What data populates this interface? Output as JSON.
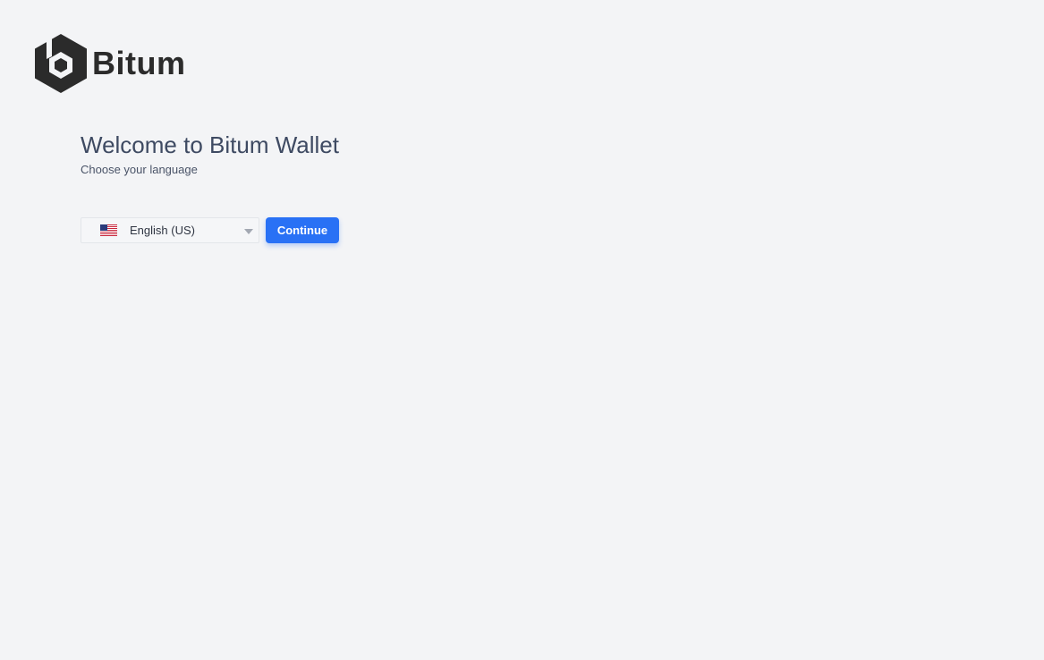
{
  "brand": {
    "name": "Bitum",
    "logo_icon": "bitum-hexagon-logo-icon",
    "color": "#2b2b2b"
  },
  "welcome": {
    "title": "Welcome to Bitum Wallet",
    "subtitle": "Choose your language"
  },
  "language_select": {
    "selected": "English (US)",
    "flag_icon": "us-flag-icon",
    "caret_icon": "chevron-down-icon"
  },
  "actions": {
    "continue_label": "Continue",
    "accent_color": "#2971f5"
  }
}
